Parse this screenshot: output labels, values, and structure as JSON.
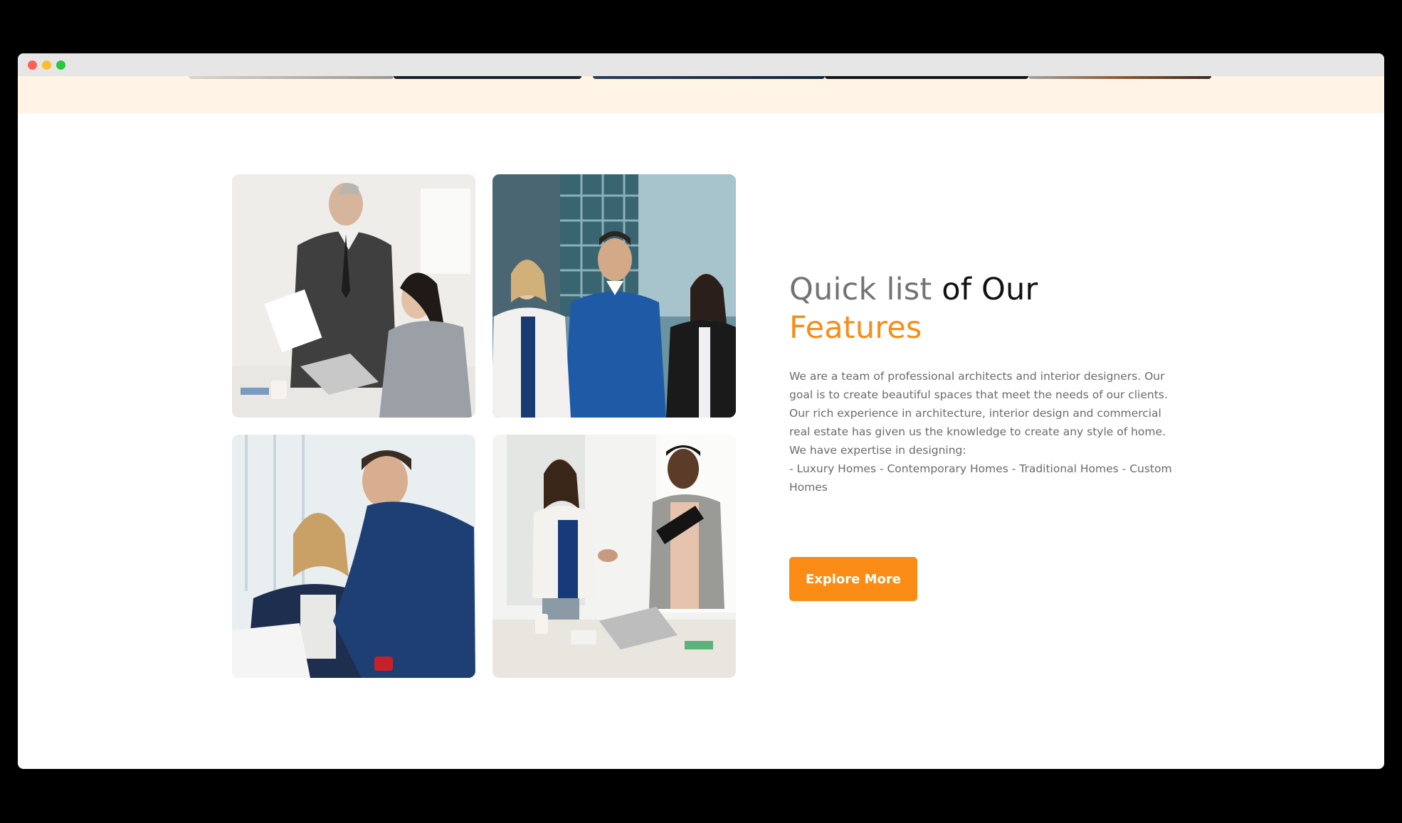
{
  "window": {
    "controls": [
      "close",
      "minimize",
      "maximize"
    ]
  },
  "features": {
    "heading_part1": "Quick list",
    "heading_part2": "of Our",
    "heading_part3": "Features",
    "paragraph_lines": [
      "We are a team of professional architects and interior designers. Our goal is to create beautiful spaces that meet the needs of our clients.",
      "Our rich experience in architecture, interior design and commercial real estate has given us the knowledge to create any style of home.",
      "We have expertise in designing:",
      "- Luxury Homes - Contemporary Homes - Traditional Homes - Custom Homes"
    ],
    "button_label": "Explore More"
  },
  "photos": [
    {
      "name": "office-meeting-photo"
    },
    {
      "name": "business-team-building-photo"
    },
    {
      "name": "colleagues-laptop-photo"
    },
    {
      "name": "handshake-office-photo"
    }
  ],
  "colors": {
    "accent": "#fa8c16",
    "heading_grey": "#737373",
    "heading_dark": "#111111",
    "band": "#fff4e6",
    "text": "#6b6b6b"
  }
}
